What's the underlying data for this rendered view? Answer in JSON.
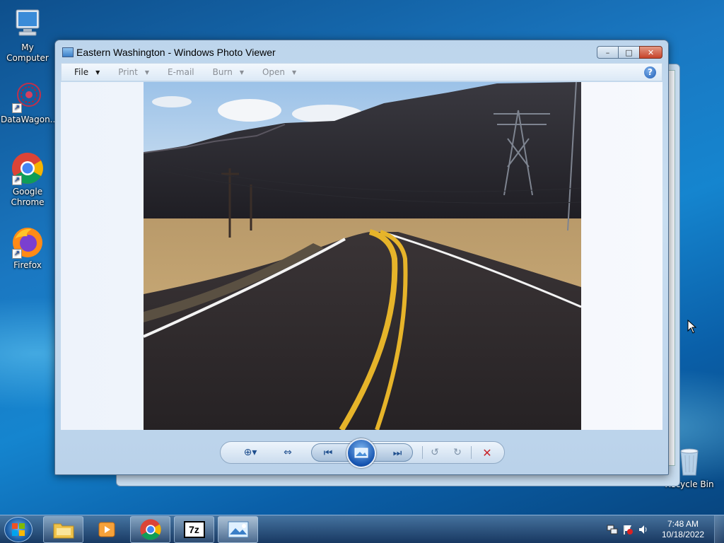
{
  "desktop": {
    "icons": [
      {
        "label": "My Computer"
      },
      {
        "label": "DataWagon..."
      },
      {
        "label": "Google Chrome"
      },
      {
        "label": "Firefox"
      },
      {
        "label": "Recycle Bin"
      }
    ]
  },
  "window": {
    "title": "Eastern Washington - Windows Photo Viewer",
    "caption_buttons": {
      "minimize": "–",
      "maximize": "□",
      "close": "✕"
    }
  },
  "menubar": {
    "items": [
      {
        "label": "File",
        "enabled": true,
        "has_dropdown": true
      },
      {
        "label": "Print",
        "enabled": false,
        "has_dropdown": true
      },
      {
        "label": "E-mail",
        "enabled": false,
        "has_dropdown": false
      },
      {
        "label": "Burn",
        "enabled": false,
        "has_dropdown": true
      },
      {
        "label": "Open",
        "enabled": false,
        "has_dropdown": true
      }
    ],
    "help": "?"
  },
  "toolbar_icons": [
    "zoom-icon",
    "actual-size-icon",
    "previous-icon",
    "slideshow-icon",
    "next-icon",
    "rotate-counterclockwise-icon",
    "rotate-clockwise-icon",
    "delete-icon"
  ],
  "taskbar": {
    "pinned": [
      "explorer-icon",
      "media-player-icon",
      "chrome-icon",
      "7zip-icon",
      "photo-viewer-icon"
    ],
    "sevenzip_label": "7z",
    "clock": {
      "time": "7:48 AM",
      "date": "10/18/2022"
    }
  },
  "colors": {
    "accent": "#1d5ea6",
    "close_button": "#c6432a",
    "road_line": "#e6b42a"
  }
}
